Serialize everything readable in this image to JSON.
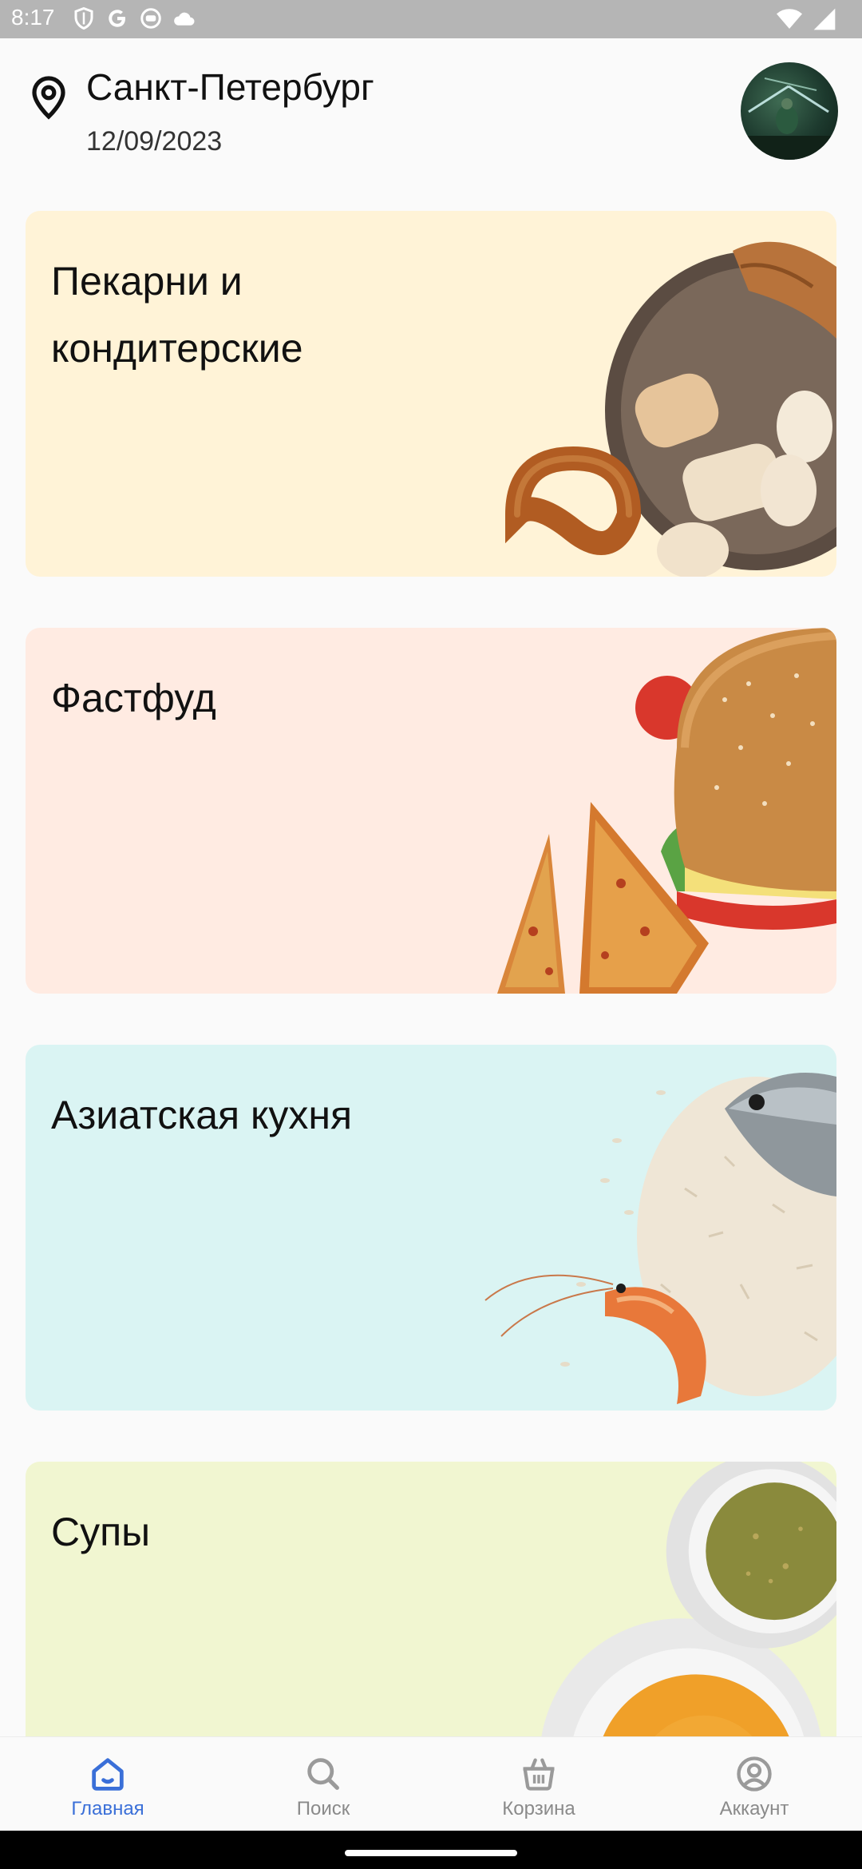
{
  "status_bar": {
    "time": "8:17",
    "icons": [
      "shield-icon",
      "google-icon",
      "bot-icon",
      "cloud-icon",
      "wifi-icon",
      "signal-icon"
    ]
  },
  "header": {
    "city": "Санкт-Петербург",
    "date": "12/09/2023",
    "location_icon": "map-pin-icon"
  },
  "categories": [
    {
      "title": "Пекарни и кондитерские",
      "background": "#fff3d7"
    },
    {
      "title": "Фастфуд",
      "background": "#ffebe2"
    },
    {
      "title": "Азиатская кухня",
      "background": "#daf4f3"
    },
    {
      "title": "Супы",
      "background": "#f1f6d1"
    }
  ],
  "bottom_nav": {
    "accent": "#3a6fd8",
    "items": [
      {
        "label": "Главная",
        "icon": "home-icon",
        "active": true
      },
      {
        "label": "Поиск",
        "icon": "search-icon",
        "active": false
      },
      {
        "label": "Корзина",
        "icon": "basket-icon",
        "active": false
      },
      {
        "label": "Аккаунт",
        "icon": "account-icon",
        "active": false
      }
    ]
  }
}
